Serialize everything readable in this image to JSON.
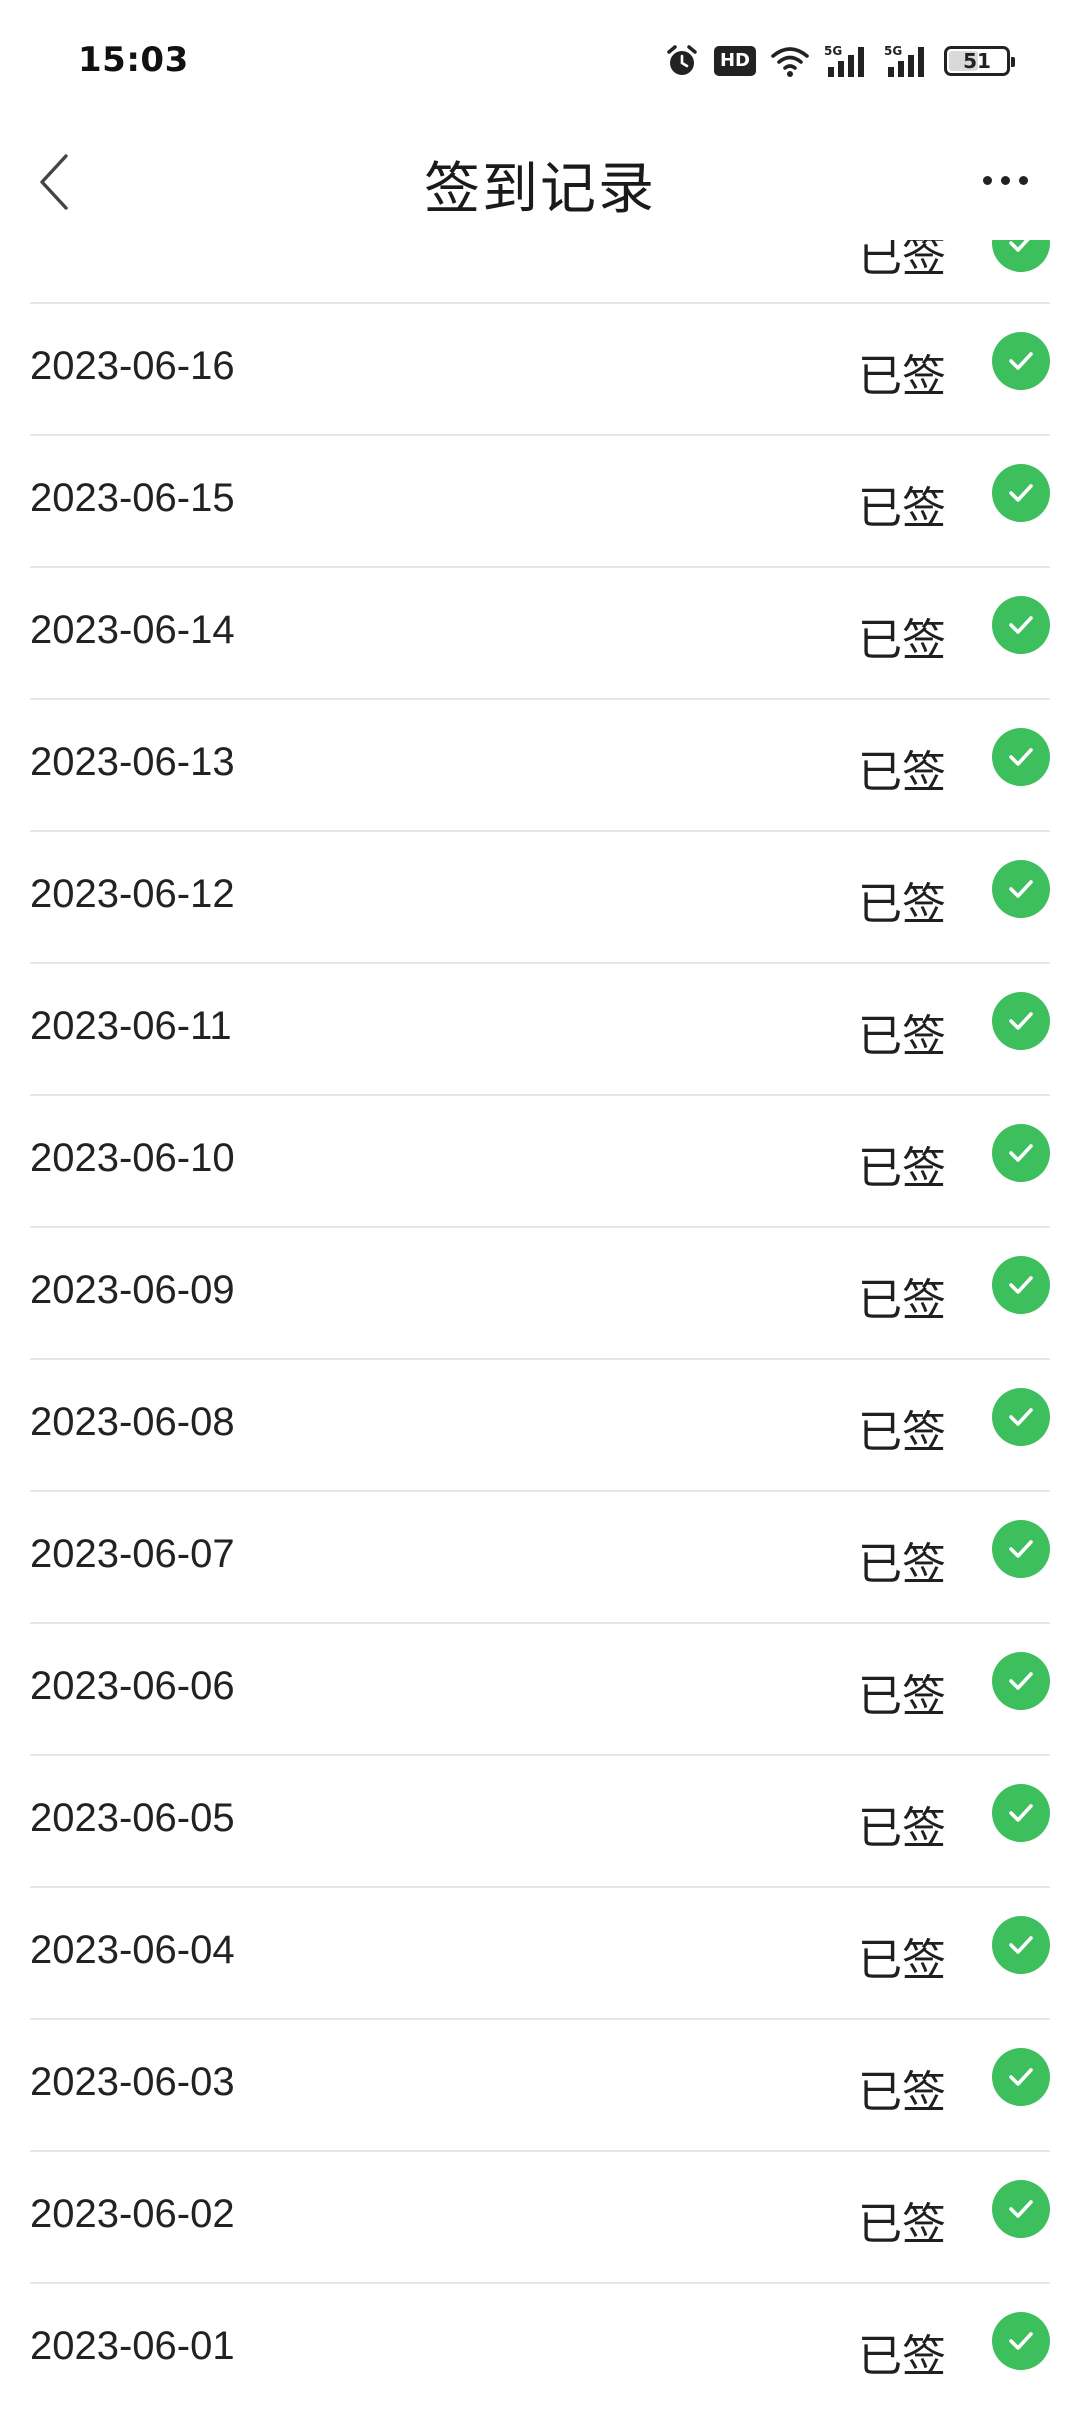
{
  "status_bar": {
    "time": "15:03",
    "hd_label": "HD",
    "network_1": "5G",
    "network_2": "5G",
    "battery": "51",
    "battery_level": 0.51
  },
  "nav": {
    "title": "签到记录",
    "back_icon": "chevron-left-icon",
    "more_icon": "more-horizontal-icon"
  },
  "records": [
    {
      "date": "",
      "status": "已签"
    },
    {
      "date": "2023-06-16",
      "status": "已签"
    },
    {
      "date": "2023-06-15",
      "status": "已签"
    },
    {
      "date": "2023-06-14",
      "status": "已签"
    },
    {
      "date": "2023-06-13",
      "status": "已签"
    },
    {
      "date": "2023-06-12",
      "status": "已签"
    },
    {
      "date": "2023-06-11",
      "status": "已签"
    },
    {
      "date": "2023-06-10",
      "status": "已签"
    },
    {
      "date": "2023-06-09",
      "status": "已签"
    },
    {
      "date": "2023-06-08",
      "status": "已签"
    },
    {
      "date": "2023-06-07",
      "status": "已签"
    },
    {
      "date": "2023-06-06",
      "status": "已签"
    },
    {
      "date": "2023-06-05",
      "status": "已签"
    },
    {
      "date": "2023-06-04",
      "status": "已签"
    },
    {
      "date": "2023-06-03",
      "status": "已签"
    },
    {
      "date": "2023-06-02",
      "status": "已签"
    },
    {
      "date": "2023-06-01",
      "status": "已签"
    }
  ],
  "colors": {
    "check_green": "#3cbf5c",
    "divider": "#e6e6e6"
  }
}
